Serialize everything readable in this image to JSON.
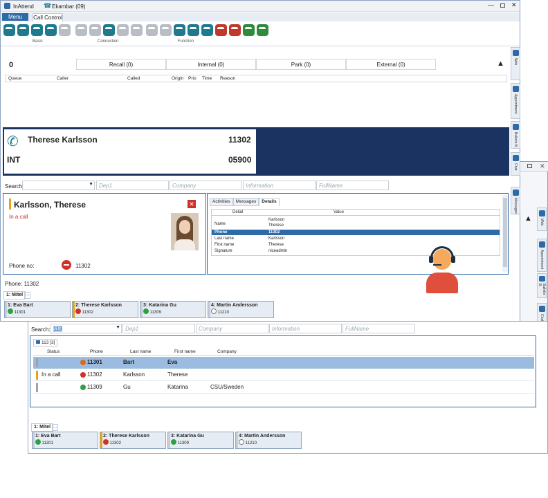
{
  "window": {
    "tab_app": "InAttend",
    "tab_ext": "Ekambar (09)"
  },
  "ribbon": {
    "tab_menu": "Menu",
    "tab_call": "Call Control",
    "groups": [
      "Basic",
      "Connection",
      "Function"
    ]
  },
  "queue": {
    "count": "0",
    "buttons": [
      "Recall (0)",
      "Internal (0)",
      "Park (0)",
      "External (0)"
    ],
    "columns": [
      "Queue",
      "Caller",
      "Called",
      "Origin",
      "Prio",
      "Time",
      "Reason"
    ]
  },
  "call": {
    "name": "Therese Karlsson",
    "number": "11302",
    "type": "INT",
    "type_number": "05900"
  },
  "search": {
    "label": "Search:",
    "placeholders": [
      "Dep1",
      "Company",
      "Information",
      "FullName"
    ]
  },
  "contact": {
    "name": "Karlsson, Therese",
    "status": "In a call",
    "phone_label": "Phone no:",
    "phone": "11302",
    "tabs": [
      "Activities",
      "Messages",
      "Details"
    ],
    "columns": [
      "Detail",
      "Value"
    ],
    "rows": [
      {
        "d": "Name",
        "v": "Karlsson\nTherese"
      },
      {
        "d": "Phone",
        "v": "11302"
      },
      {
        "d": "Last name",
        "v": "Karlsson"
      },
      {
        "d": "First name",
        "v": "Therese"
      },
      {
        "d": "Signature",
        "v": "niceadmin"
      }
    ]
  },
  "phone_line": "Phone: 11302",
  "mitel_tab": "1: Mitel",
  "extensions": [
    {
      "label": "1: Eva Bart",
      "num": "11301",
      "status": "g",
      "bar": "#c8ced6"
    },
    {
      "label": "2: Therese Karlsson",
      "num": "11302",
      "status": "r",
      "bar": "#e8a317"
    },
    {
      "label": "3: Katarina Gu",
      "num": "11309",
      "status": "g",
      "bar": "#c8ced6"
    },
    {
      "label": "4: Martin Andersson",
      "num": "11210",
      "status": "e",
      "bar": "#c8ced6"
    }
  ],
  "side_tabs": [
    "Web",
    "Appointment",
    "Bulletin B.",
    "Chat",
    "Messages"
  ],
  "front": {
    "search_value": "113",
    "tab": "113 [3]",
    "columns": [
      "Status",
      "Phone",
      "Last name",
      "First name",
      "Company"
    ],
    "rows": [
      {
        "status": "",
        "phone": "11301",
        "last": "Bart",
        "first": "Eva",
        "company": "",
        "dot": "o",
        "sel": true
      },
      {
        "status": "In a call",
        "phone": "11302",
        "last": "Karlsson",
        "first": "Therese",
        "company": "",
        "dot": "r",
        "sel": false
      },
      {
        "status": "",
        "phone": "11309",
        "last": "Gu",
        "first": "Katarina",
        "company": "CSU/Sweden",
        "dot": "g",
        "sel": false
      }
    ]
  }
}
